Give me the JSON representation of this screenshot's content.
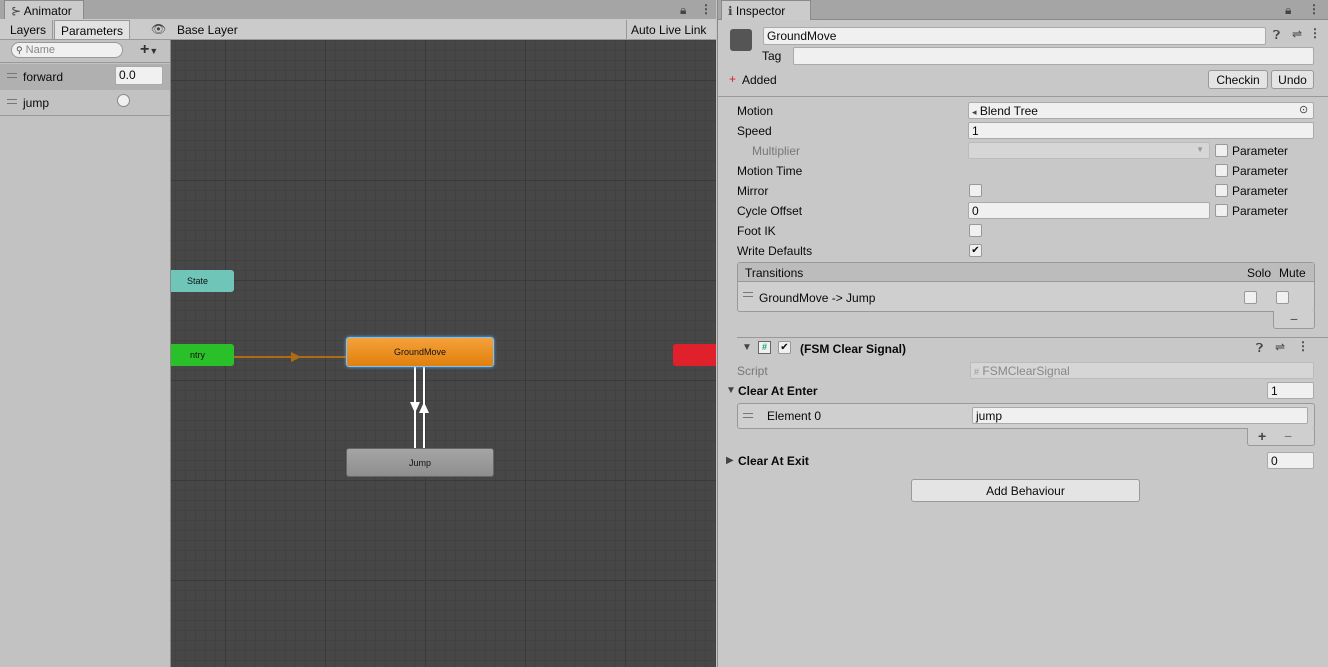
{
  "animator": {
    "tab_title": "Animator",
    "tabs": [
      "Layers",
      "Parameters"
    ],
    "breadcrumb": "Base Layer",
    "auto_live_link": "Auto Live Link",
    "search_placeholder": "Name",
    "params": [
      {
        "name": "forward",
        "value": "0.0"
      },
      {
        "name": "jump",
        "value": ""
      }
    ],
    "nodes": {
      "any_state": "State",
      "entry": "ntry",
      "groundmove": "GroundMove",
      "jump": "Jump"
    },
    "colors": {
      "groundmove": "#f08b14",
      "entry": "#2ac02a",
      "any_state": "#6fc6b8",
      "exit": "#e0202a",
      "jump": "#9a9a9a"
    }
  },
  "inspector": {
    "tab_title": "Inspector",
    "object_name": "GroundMove",
    "tag_label": "Tag",
    "tag_value": "",
    "added_label": "Added",
    "checkin_label": "Checkin",
    "undo_label": "Undo",
    "motion_label": "Motion",
    "motion_value": "Blend Tree",
    "speed_label": "Speed",
    "speed_value": "1",
    "multiplier_label": "Multiplier",
    "parameter_label": "Parameter",
    "motion_time_label": "Motion Time",
    "mirror_label": "Mirror",
    "cycle_offset_label": "Cycle Offset",
    "cycle_offset_value": "0",
    "foot_ik_label": "Foot IK",
    "write_defaults_label": "Write Defaults",
    "transitions": {
      "header": "Transitions",
      "solo": "Solo",
      "mute": "Mute",
      "rows": [
        "GroundMove -> Jump"
      ]
    },
    "component": {
      "title": "(FSM Clear Signal)",
      "script_label": "Script",
      "script_value": "FSMClearSignal",
      "clear_enter_label": "Clear At Enter",
      "clear_enter_count": "1",
      "element_label": "Element 0",
      "element_value": "jump",
      "clear_exit_label": "Clear At Exit",
      "clear_exit_count": "0"
    },
    "add_behaviour": "Add Behaviour"
  }
}
